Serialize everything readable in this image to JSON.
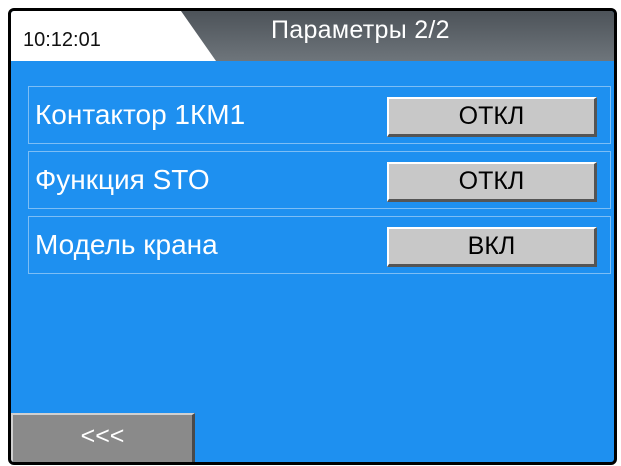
{
  "header": {
    "time": "10:12:01",
    "title": "Параметры 2/2"
  },
  "rows": [
    {
      "label": "Контактор 1КМ1",
      "value": "ОТКЛ"
    },
    {
      "label": "Функция STO",
      "value": "ОТКЛ"
    },
    {
      "label": "Модель крана",
      "value": "ВКЛ"
    }
  ],
  "footer": {
    "back_label": "<<<"
  },
  "colors": {
    "background": "#1E90F0",
    "header_dark": "#5a6168",
    "button_face": "#c8c8c8",
    "back_button_face": "#8a8a8a"
  }
}
